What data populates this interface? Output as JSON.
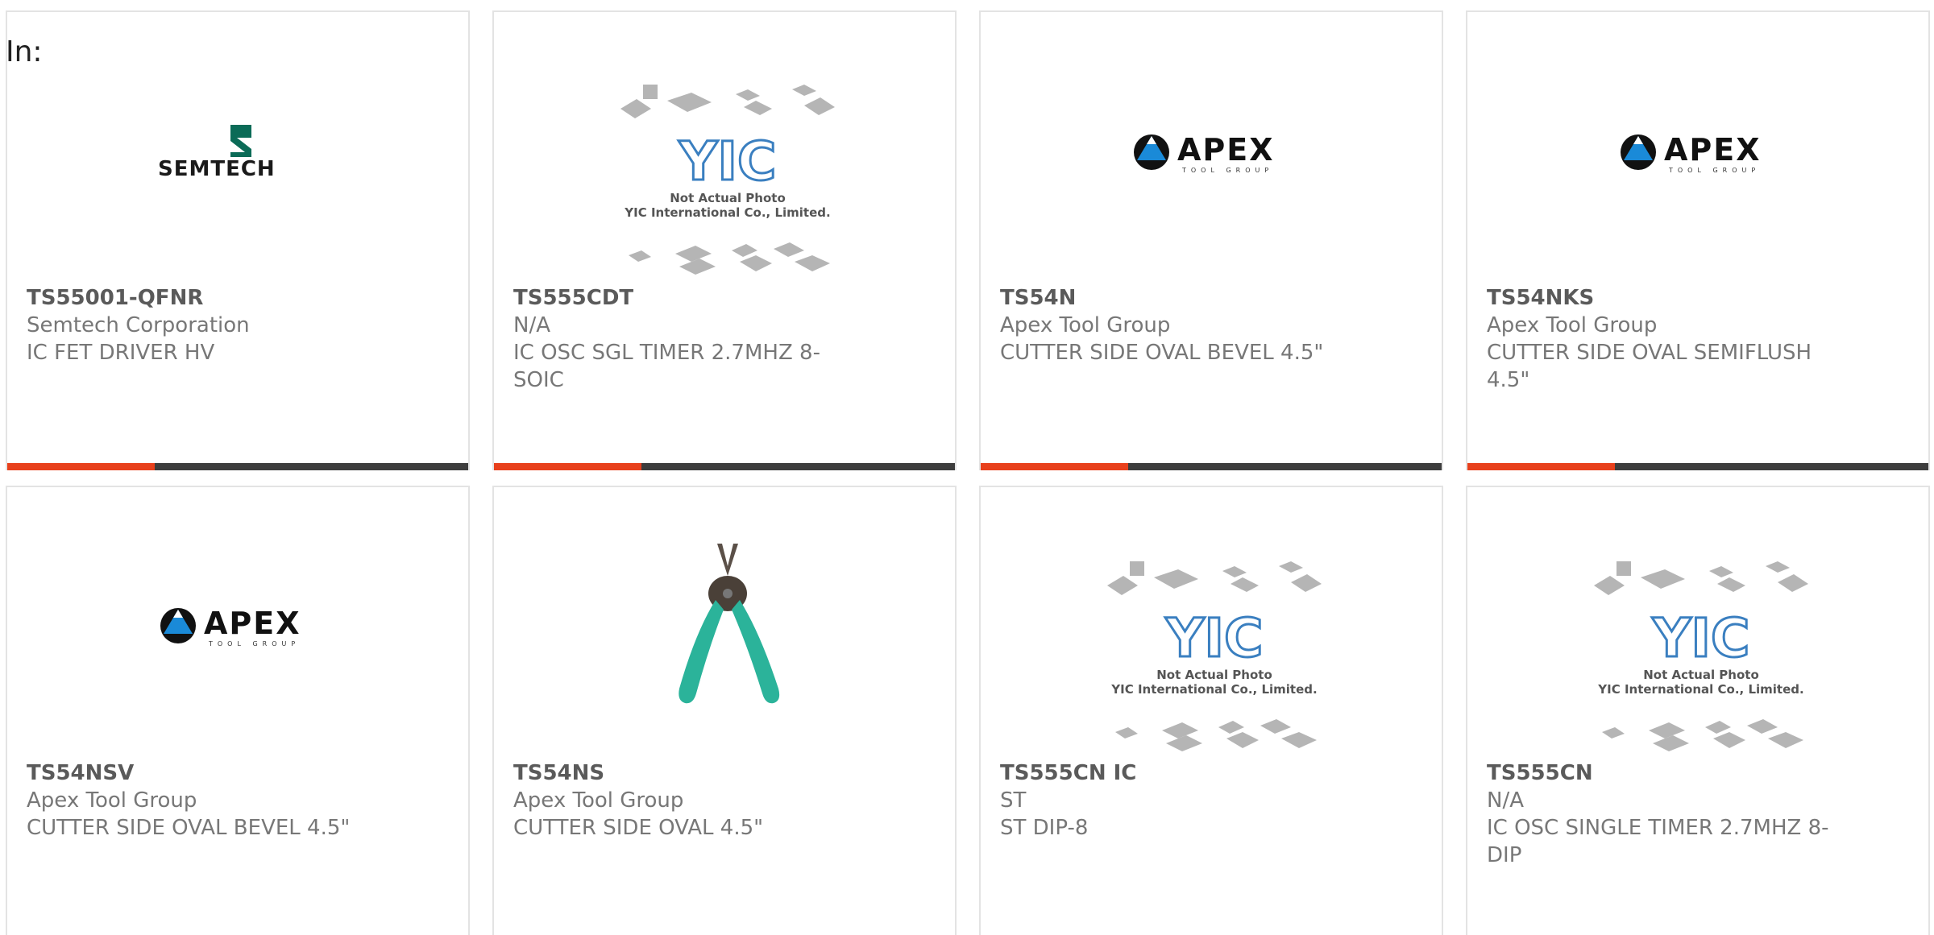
{
  "filter": {
    "label": "In:"
  },
  "colors": {
    "accent": "#e8401c",
    "bar": "#3d3d3d",
    "border": "#e3e3e3"
  },
  "products": [
    {
      "part": "TS55001-QFNR",
      "manufacturer": "Semtech Corporation",
      "description": "IC FET DRIVER HV",
      "image": "semtech-logo",
      "logo_text": "SEMTECH"
    },
    {
      "part": "TS555CDT",
      "manufacturer": "N/A",
      "description": "IC OSC SGL TIMER 2.7MHZ 8-SOIC",
      "image": "yic-placeholder",
      "placeholder_line1": "Not Actual Photo",
      "placeholder_line2": "YIC International Co., Limited."
    },
    {
      "part": "TS54N",
      "manufacturer": "Apex Tool Group",
      "description": "CUTTER SIDE OVAL BEVEL 4.5\"",
      "image": "apex-logo",
      "logo_text": "APEX",
      "logo_sub": "TOOL GROUP"
    },
    {
      "part": "TS54NKS",
      "manufacturer": "Apex Tool Group",
      "description": "CUTTER SIDE OVAL SEMIFLUSH 4.5\"",
      "image": "apex-logo",
      "logo_text": "APEX",
      "logo_sub": "TOOL GROUP"
    },
    {
      "part": "TS54NSV",
      "manufacturer": "Apex Tool Group",
      "description": "CUTTER SIDE OVAL BEVEL 4.5\"",
      "image": "apex-logo",
      "logo_text": "APEX",
      "logo_sub": "TOOL GROUP"
    },
    {
      "part": "TS54NS",
      "manufacturer": "Apex Tool Group",
      "description": "CUTTER SIDE OVAL 4.5\"",
      "image": "pliers-photo"
    },
    {
      "part": "TS555CN IC",
      "manufacturer": "ST",
      "description": "ST DIP-8",
      "image": "yic-placeholder",
      "placeholder_line1": "Not Actual Photo",
      "placeholder_line2": "YIC International Co., Limited."
    },
    {
      "part": "TS555CN",
      "manufacturer": "N/A",
      "description": "IC OSC SINGLE TIMER 2.7MHZ 8-DIP",
      "image": "yic-placeholder",
      "placeholder_line1": "Not Actual Photo",
      "placeholder_line2": "YIC International Co., Limited."
    }
  ]
}
